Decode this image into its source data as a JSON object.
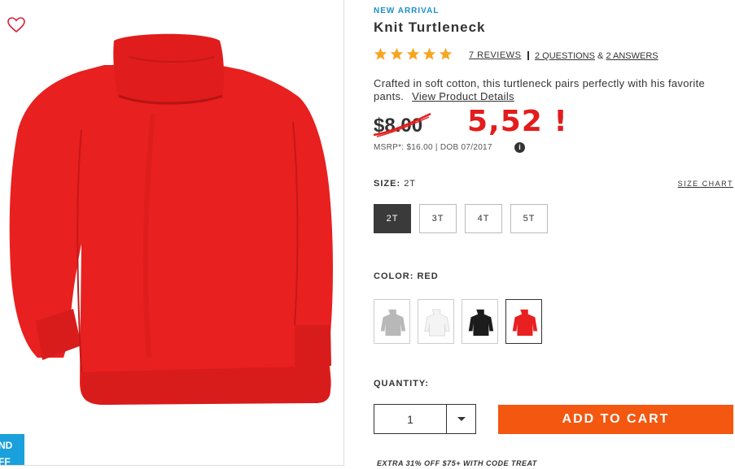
{
  "badge": "NEW ARRIVAL",
  "title": "Knit Turtleneck",
  "rating": {
    "stars": 5
  },
  "reviews": "7 REVIEWS",
  "questions": "2 QUESTIONS",
  "qa_amp": "&",
  "answers": "2 ANSWERS",
  "description": "Crafted in soft cotton, this turtleneck pairs perfectly with his favorite pants.",
  "view_details": "View Product Details",
  "price_old": "$8.00",
  "price_new": "5,52 !",
  "msrp": "MSRP*: $16.00  |  DOB 07/2017",
  "info_icon": "i",
  "size": {
    "label": "SIZE:",
    "value": "2T",
    "chart": "SIZE CHART",
    "options": [
      "2T",
      "3T",
      "4T",
      "5T"
    ],
    "selected": "2T"
  },
  "color": {
    "label": "COLOR:",
    "value": "RED",
    "swatches": [
      {
        "name": "gray",
        "color": "#b8b8b8"
      },
      {
        "name": "white",
        "color": "#f4f4f4"
      },
      {
        "name": "black",
        "color": "#1c1c1c"
      },
      {
        "name": "red",
        "color": "#e8201f"
      }
    ]
  },
  "quantity": {
    "label": "QUANTITY:",
    "value": "1"
  },
  "add_to_cart": "ADD TO CART",
  "promo_line": "EXTRA 31% OFF $75+ WITH CODE TREAT",
  "promo_tab": [
    "ND",
    "FF"
  ],
  "colors": {
    "accent": "#f35710",
    "link_blue": "#1c8ec8",
    "sale_red": "#e31c1c",
    "product_red": "#e8201f"
  }
}
